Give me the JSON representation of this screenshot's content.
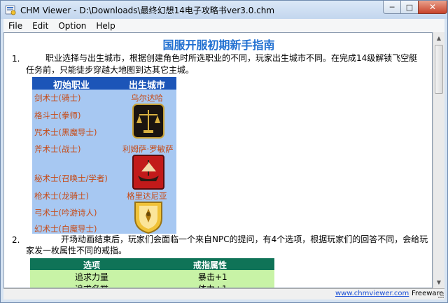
{
  "window": {
    "title": "CHM Viewer - D:\\Downloads\\最终幻想14电子攻略书ver3.0.chm",
    "controls": {
      "minimize": "─",
      "maximize": "□",
      "close": "✕"
    }
  },
  "menu": [
    "File",
    "Edit",
    "Option",
    "Help"
  ],
  "doc": {
    "title": "国服开服初期新手指南",
    "section1": {
      "number": "1.",
      "line1": "职业选择与出生城市，根据创建角色时所选职业的不同，玩家出生城市不同。在完成14级解锁飞空艇",
      "line2": "任务前，只能徒步穿越大地图到达其它主城。"
    },
    "city_table": {
      "headers": [
        "初始职业",
        "出生城市"
      ],
      "jobs": [
        "剑术士(骑士)",
        "格斗士(拳师)",
        "咒术士(黑魔导士)",
        "斧术士(战士)",
        "秘术士(召唤士/学者)",
        "枪术士(龙骑士)",
        "弓术士(吟游诗人)",
        "幻术士(白魔导士)"
      ],
      "cities": [
        "乌尔达哈",
        "利姆萨·罗敏萨",
        "格里达尼亚"
      ]
    },
    "section2": {
      "number": "2.",
      "line1": "开场动画结束后，玩家们会面临一个来自NPC的提问，有4个选项，根据玩家们的回答不同，会给玩",
      "line2": "家发一枚属性不同的戒指。"
    },
    "choice_table": {
      "headers": [
        "选项",
        "戒指属性"
      ],
      "rows": [
        {
          "option": "追求力量",
          "attr": "暴击+1"
        },
        {
          "option": "追求名誉",
          "attr": "体力+1"
        }
      ]
    }
  },
  "status": {
    "link": "www.chmviewer.com",
    "label": "Freeware"
  },
  "colors": {
    "title_blue": "#1f6fd1",
    "city_header": "#1c55b8",
    "city_bg": "#a7c8f2",
    "job_text": "#c64a16",
    "choice_header": "#0f7357",
    "choice_row": "#c8f3a6"
  }
}
